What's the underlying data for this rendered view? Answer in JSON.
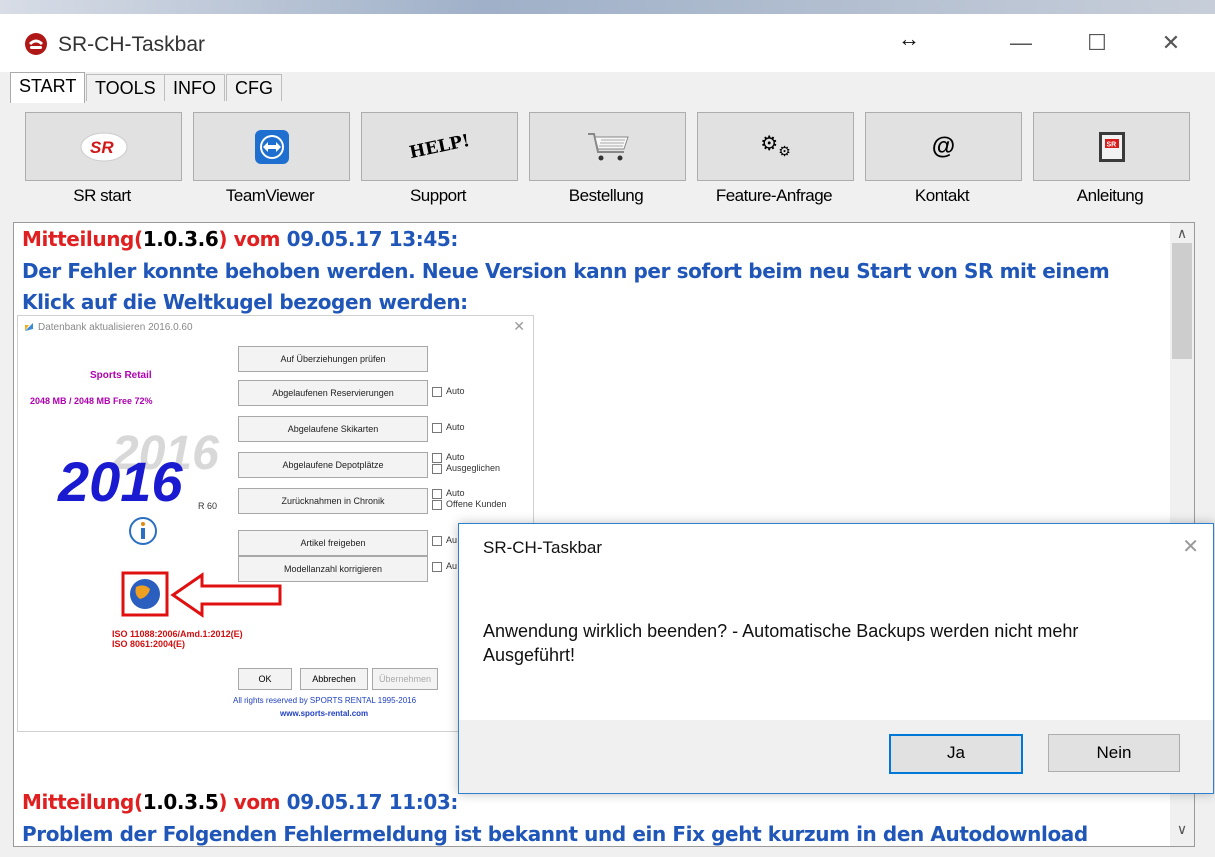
{
  "window": {
    "title": "SR-CH-Taskbar",
    "resize_glyph": "↔",
    "min_glyph": "—",
    "max_glyph": "☐",
    "close_glyph": "✕"
  },
  "tabs": [
    {
      "label": "START"
    },
    {
      "label": "TOOLS"
    },
    {
      "label": "INFO"
    },
    {
      "label": "CFG"
    }
  ],
  "toolbar": [
    {
      "label": "SR start",
      "icon": "sr-logo-icon"
    },
    {
      "label": "TeamViewer",
      "icon": "teamviewer-icon"
    },
    {
      "label": "Support",
      "icon": "help-icon",
      "icon_text": "HELP!"
    },
    {
      "label": "Bestellung",
      "icon": "cart-icon"
    },
    {
      "label": "Feature-Anfrage",
      "icon": "gears-icon",
      "icon_text": "⚙"
    },
    {
      "label": "Kontakt",
      "icon": "at-icon",
      "icon_text": "@"
    },
    {
      "label": "Anleitung",
      "icon": "manual-icon",
      "icon_text": "SR"
    }
  ],
  "messages": [
    {
      "prefix": "Mitteilung(",
      "version": "1.0.3.6",
      "suffix": ") vom ",
      "date": "09.05.17 13:45:",
      "body": "Der Fehler konnte behoben werden. Neue Version kann per sofort beim neu Start von SR mit einem Klick auf die Weltkugel bezogen werden:"
    },
    {
      "prefix": "Mitteilung(",
      "version": "1.0.3.5",
      "suffix": ") vom ",
      "date": "09.05.17 11:03:",
      "body": "Problem der Folgenden Fehlermeldung ist bekannt und ein Fix geht kurzum in den Autodownload"
    }
  ],
  "embedded_screenshot": {
    "title": "Datenbank aktualisieren 2016.0.60",
    "close": "✕",
    "brand": "Sports Retail",
    "memory": "2048 MB / 2048 MB Free 72%",
    "year": "2016",
    "year_shadow": "2016",
    "version": "R 60",
    "buttons": [
      "Auf Überziehungen prüfen",
      "Abgelaufenen Reservierungen",
      "Abgelaufene Skikarten",
      "Abgelaufene Depotplätze",
      "Zurücknahmen in Chronik",
      "Artikel freigeben",
      "Modellanzahl korrigieren"
    ],
    "checkboxes": [
      "Auto",
      "Auto",
      "Auto",
      "Ausgeglichen",
      "Auto",
      "Offene Kunden",
      "Au",
      "Au"
    ],
    "iso_lines": [
      "ISO 11088:2006/Amd.1:2012(E)",
      "ISO 8061:2004(E)"
    ],
    "ok": "OK",
    "cancel": "Abbrechen",
    "apply": "Übernehmen",
    "rights": "All rights reserved by SPORTS RENTAL 1995-2016",
    "url": "www.sports-rental.com"
  },
  "dialog": {
    "title": "SR-CH-Taskbar",
    "close": "✕",
    "message": "Anwendung wirklich beenden? - Automatische Backups werden nicht mehr Ausgeführt!",
    "yes": "Ja",
    "no": "Nein"
  },
  "scrollbar": {
    "up": "∧",
    "down": "∨"
  },
  "colors": {
    "accent_red": "#e02020",
    "accent_blue": "#1f56b8",
    "dialog_border": "#2f7fd0"
  }
}
